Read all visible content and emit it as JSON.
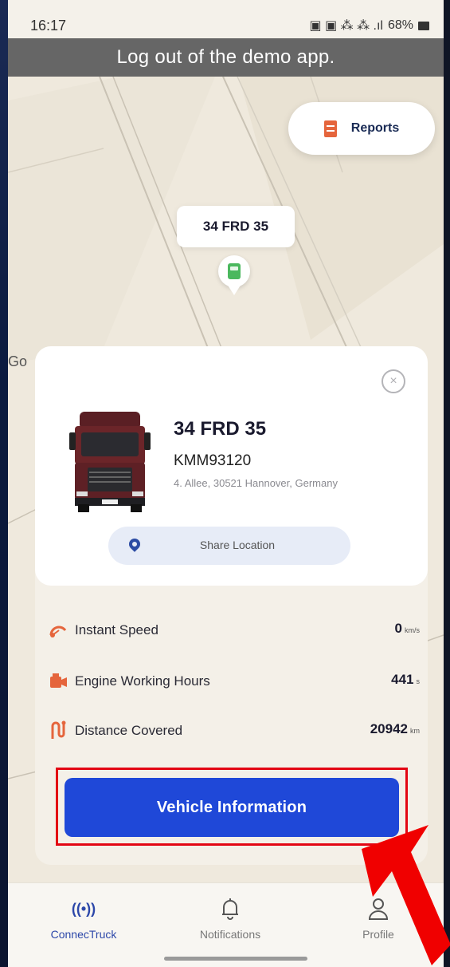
{
  "status_bar": {
    "time": "16:17",
    "indicators": "▣ ▣ ⁂ ⁂ .ıl",
    "battery": "68%"
  },
  "banner": {
    "text": "Log out of the demo app."
  },
  "map": {
    "reports_label": "Reports",
    "vehicle_plate": "34 FRD 35",
    "google_mark": "Go"
  },
  "vehicle_card": {
    "plate": "34 FRD 35",
    "vin": "KMM93120",
    "address": "4. Allee, 30521 Hannover, Germany",
    "share_label": "Share Location",
    "close_icon": "×"
  },
  "metrics": [
    {
      "label": "Instant Speed",
      "value": "0",
      "unit": "km/s",
      "icon": "speedometer-icon",
      "color": "#e5653c"
    },
    {
      "label": "Engine Working Hours",
      "value": "441",
      "unit": "s",
      "icon": "engine-icon",
      "color": "#e5653c"
    },
    {
      "label": "Distance Covered",
      "value": "20942",
      "unit": "km",
      "icon": "route-icon",
      "color": "#e5653c"
    }
  ],
  "primary_action": {
    "label": "Vehicle Information",
    "color": "#1f48d8"
  },
  "tabs": [
    {
      "label": "ConnecTruck",
      "icon": "broadcast-icon",
      "active": true
    },
    {
      "label": "Notifications",
      "icon": "bell-icon",
      "active": false
    },
    {
      "label": "Profile",
      "icon": "user-icon",
      "active": false
    }
  ],
  "colors": {
    "accent": "#1f48d8",
    "highlight_box": "#e30613",
    "icon_orange": "#e5653c",
    "active_tab": "#2c47a9"
  }
}
